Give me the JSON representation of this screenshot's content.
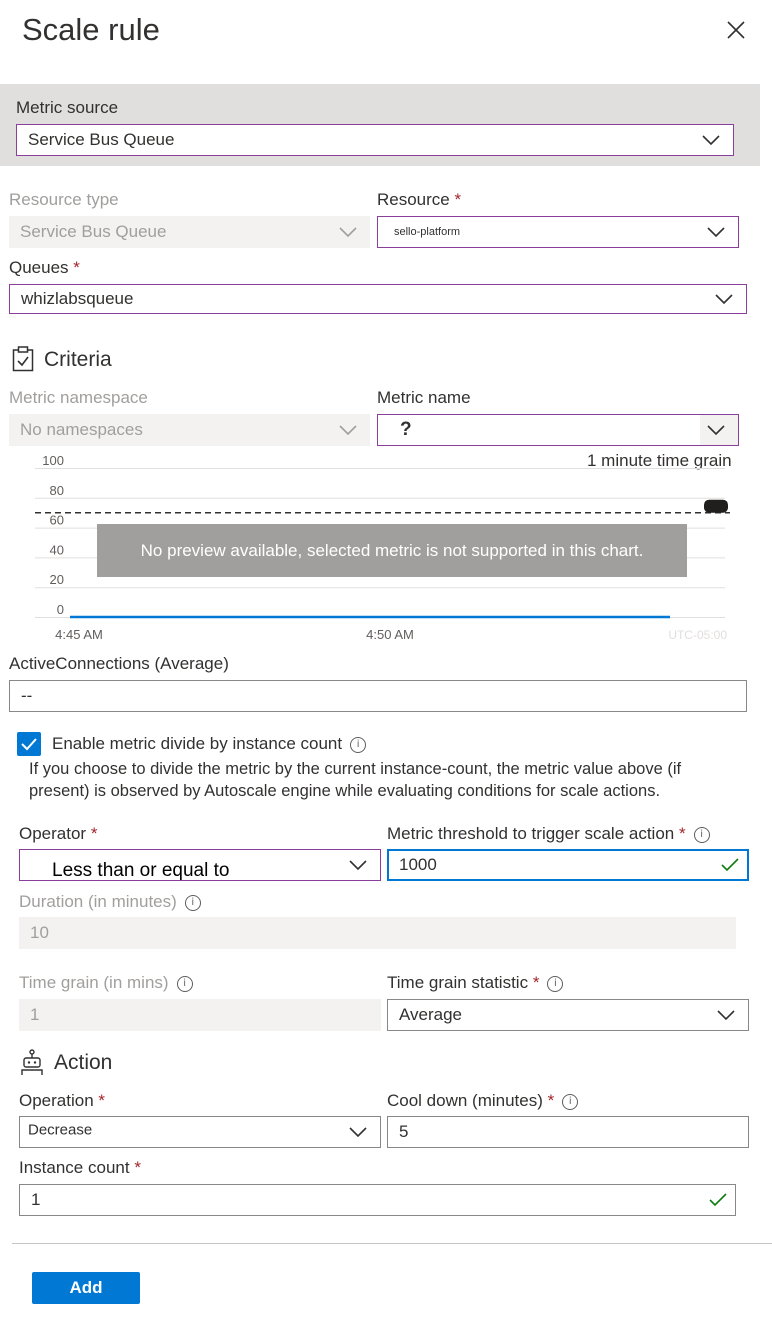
{
  "panel": {
    "title": "Scale rule"
  },
  "metric_source": {
    "label": "Metric source",
    "value": "Service Bus Queue"
  },
  "resource_type": {
    "label": "Resource type",
    "value": "Service Bus Queue"
  },
  "resource": {
    "label": "Resource",
    "required": "*",
    "value": "sello-platform"
  },
  "queues": {
    "label": "Queues",
    "required": "*",
    "value": "whizlabsqueue"
  },
  "criteria": {
    "heading": "Criteria",
    "metric_namespace": {
      "label": "Metric namespace",
      "value": "No namespaces"
    },
    "metric_name": {
      "label": "Metric name",
      "value": "?"
    }
  },
  "chart": {
    "time_grain_label": "1 minute time grain",
    "y_ticks": [
      "100",
      "80",
      "60",
      "40",
      "20",
      "0"
    ],
    "x_ticks": [
      "4:45 AM",
      "4:50 AM"
    ],
    "timezone": "UTC-05:00",
    "overlay_message": "No preview available, selected metric is not supported in this chart.",
    "metric_label": "ActiveConnections (Average)",
    "metric_value": "--"
  },
  "chart_data": {
    "type": "line",
    "title": "",
    "xlabel": "",
    "ylabel": "",
    "ylim": [
      0,
      100
    ],
    "x_ticks": [
      "4:45 AM",
      "4:50 AM"
    ],
    "threshold_value": 70,
    "series": [
      {
        "values": [
          0,
          0
        ]
      }
    ]
  },
  "divide_by_instance": {
    "label": "Enable metric divide by instance count",
    "checked": true,
    "description_line1": "If you choose to divide the metric by the current instance-count, the metric value above (if",
    "description_line2": "present) is observed by Autoscale engine while evaluating conditions for scale actions."
  },
  "operator": {
    "label": "Operator",
    "required": "*",
    "value": "Less than or equal to"
  },
  "threshold": {
    "label": "Metric threshold to trigger scale action",
    "required": "*",
    "value": "1000"
  },
  "duration": {
    "label": "Duration (in minutes)",
    "value": "10"
  },
  "time_grain": {
    "label": "Time grain (in mins)",
    "value": "1"
  },
  "time_grain_statistic": {
    "label": "Time grain statistic",
    "required": "*",
    "value": "Average"
  },
  "action": {
    "heading": "Action",
    "operation": {
      "label": "Operation",
      "required": "*",
      "value": "Decrease"
    },
    "cool_down": {
      "label": "Cool down (minutes)",
      "required": "*",
      "value": "5"
    },
    "instance_count": {
      "label": "Instance count",
      "required": "*",
      "value": "1"
    }
  },
  "buttons": {
    "add": "Add"
  },
  "colors": {
    "accent": "#0078d4",
    "focus_border": "#8a3f9c",
    "required": "#a4262c",
    "success": "#107c10"
  }
}
